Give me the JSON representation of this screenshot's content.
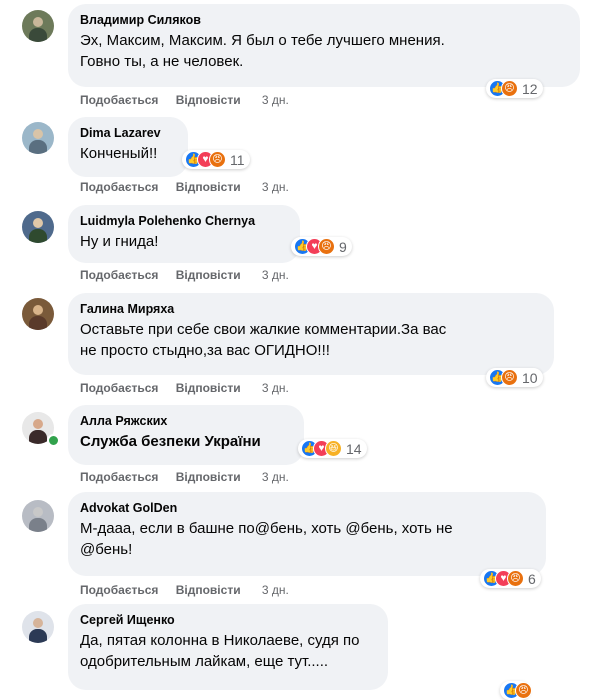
{
  "comments": [
    {
      "author": "Владимир Силяков",
      "text_lines": [
        "Эх, Максим, Максим. Я был о тебе лучшего мнения.",
        "Говно ты, а не человек."
      ],
      "like_label": "Подобається",
      "reply_label": "Відповісти",
      "time": "3 дн.",
      "reactions": [
        "like",
        "angry"
      ],
      "reaction_count": "12",
      "avatar_colors": [
        "#6d7a5a",
        "#c9b79a",
        "#3a4a3a"
      ]
    },
    {
      "author": "Dima Lazarev",
      "text_lines": [
        "Конченый!!"
      ],
      "like_label": "Подобається",
      "reply_label": "Відповісти",
      "time": "3 дн.",
      "reactions": [
        "like",
        "heart",
        "angry"
      ],
      "reaction_count": "11",
      "avatar_colors": [
        "#9bb7c9",
        "#d8c4a8",
        "#5a6f80"
      ]
    },
    {
      "author": "Luidmyla Polehenko Chernya",
      "text_lines": [
        "Ну и гнида!"
      ],
      "like_label": "Подобається",
      "reply_label": "Відповісти",
      "time": "3 дн.",
      "reactions": [
        "like",
        "heart",
        "angry"
      ],
      "reaction_count": "9",
      "avatar_colors": [
        "#4f6a8c",
        "#e0c8a8",
        "#2f4a2f"
      ]
    },
    {
      "author": "Галина Миряха",
      "text_lines": [
        "Оставьте при себе свои жалкие комментарии.За вас",
        "не просто стыдно,за вас ОГИДНО!!!"
      ],
      "like_label": "Подобається",
      "reply_label": "Відповісти",
      "time": "3 дн.",
      "reactions": [
        "like",
        "angry"
      ],
      "reaction_count": "10",
      "avatar_colors": [
        "#7a5a3a",
        "#d9b48a",
        "#5a3a2a"
      ]
    },
    {
      "author": "Алла Ряжских",
      "text_lines": [
        "Служба безпеки України"
      ],
      "like_label": "Подобається",
      "reply_label": "Відповісти",
      "time": "3 дн.",
      "reactions": [
        "like",
        "heart",
        "haha"
      ],
      "reaction_count": "14",
      "avatar_colors": [
        "#e8e8e8",
        "#d7a88a",
        "#3a2a2a"
      ]
    },
    {
      "author": "Advokat GolDen",
      "text_lines": [
        "М-дааа, если в башне по@бень, хоть @бень, хоть не",
        "@бень!"
      ],
      "like_label": "Подобається",
      "reply_label": "Відповісти",
      "time": "3 дн.",
      "reactions": [
        "like",
        "heart",
        "angry"
      ],
      "reaction_count": "6",
      "avatar_colors": [
        "#b8bcc4",
        "#c8c8c8",
        "#7a808a"
      ]
    },
    {
      "author": "Сергей Ищенко",
      "text_lines": [
        "Да, пятая колонна в Николаеве, судя по",
        "одобрительным лайкам, еще тут....."
      ],
      "like_label": "",
      "reply_label": "",
      "time": "",
      "reactions": [
        "like",
        "angry"
      ],
      "reaction_count": "",
      "avatar_colors": [
        "#dfe3ea",
        "#d6b49a",
        "#2c3a55"
      ]
    }
  ],
  "reaction_glyphs": {
    "like": "👍",
    "heart": "♥",
    "angry": "😠",
    "haha": "😆"
  }
}
